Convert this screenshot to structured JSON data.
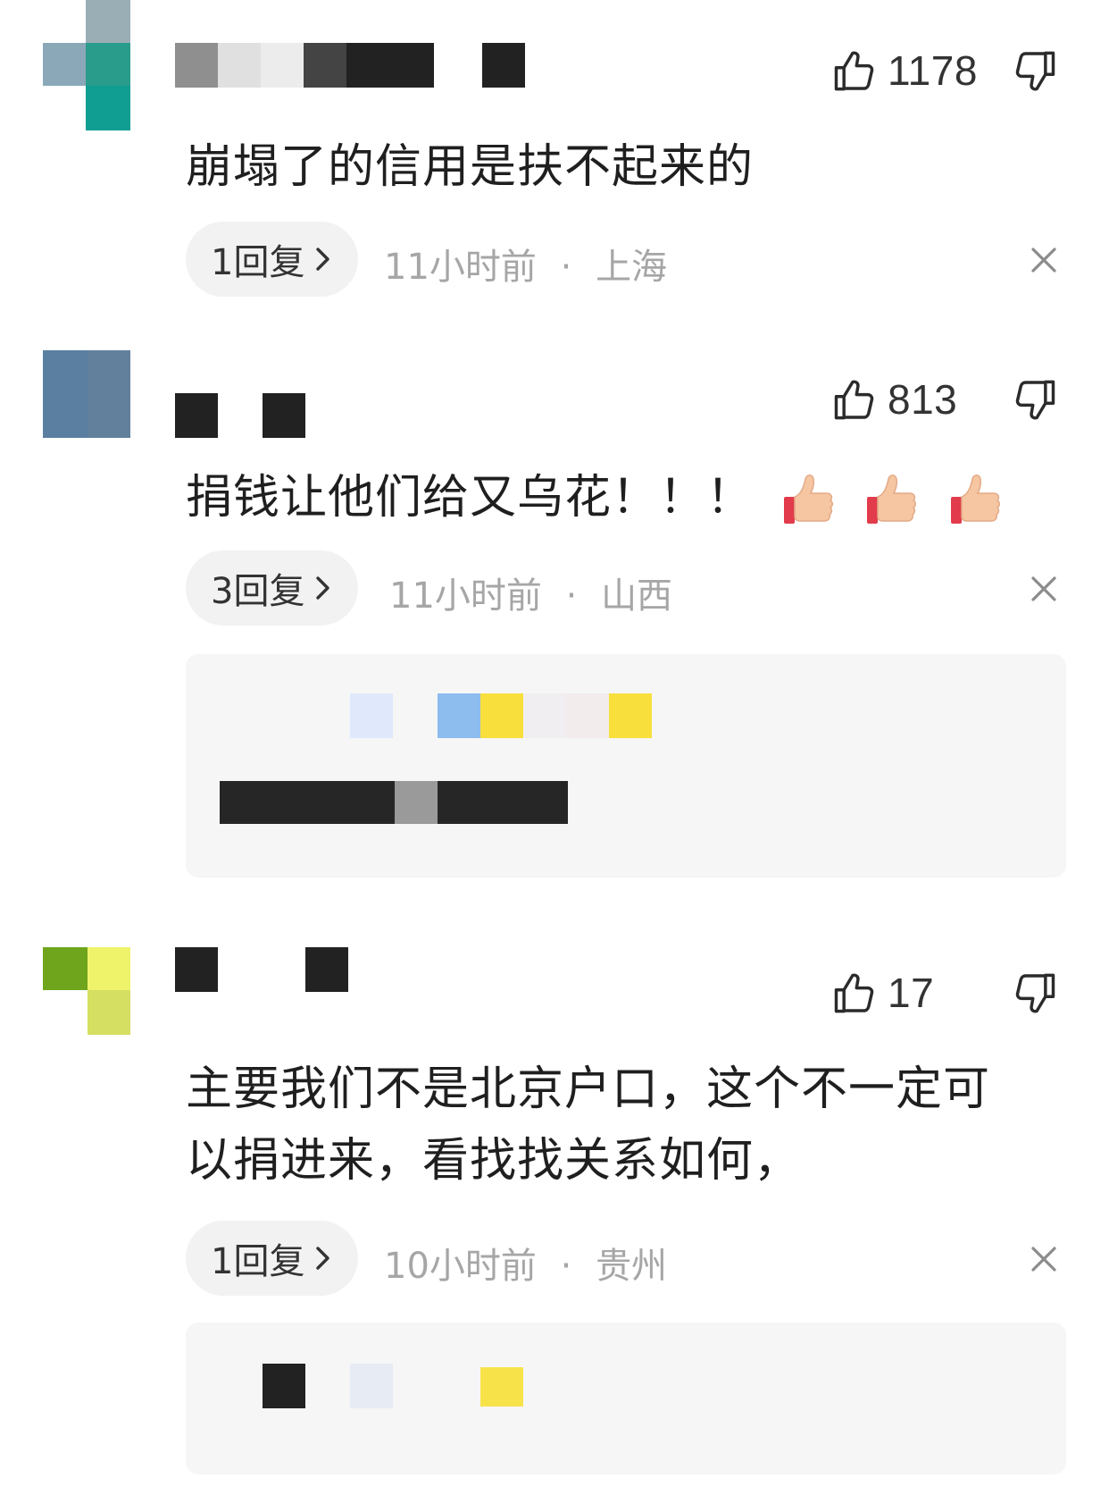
{
  "comments": [
    {
      "likes": "1178",
      "text": "崩塌了的信用是扶不起来的",
      "reply_label": "1回复",
      "time": "11小时前",
      "location": "上海",
      "separator": "·"
    },
    {
      "likes": "813",
      "text": "捐钱让他们给又乌花！！！",
      "reply_label": "3回复",
      "time": "11小时前",
      "location": "山西",
      "separator": "·"
    },
    {
      "likes": "17",
      "text_line1": "主要我们不是北京户口，这个不一定可",
      "text_line2": "以捐进来，看找找关系如何，",
      "reply_label": "1回复",
      "time": "10小时前",
      "location": "贵州",
      "separator": "·"
    }
  ],
  "icons": {
    "like": "thumbs-up-outline-icon",
    "dislike": "thumbs-down-outline-icon",
    "close": "close-icon",
    "chevron": "chevron-right-icon",
    "emoji": "thumbs-up-emoji"
  },
  "colors": {
    "pill_bg": "#f2f2f2",
    "meta_text": "#a6a6a6",
    "reply_box_bg": "#f6f6f6"
  }
}
